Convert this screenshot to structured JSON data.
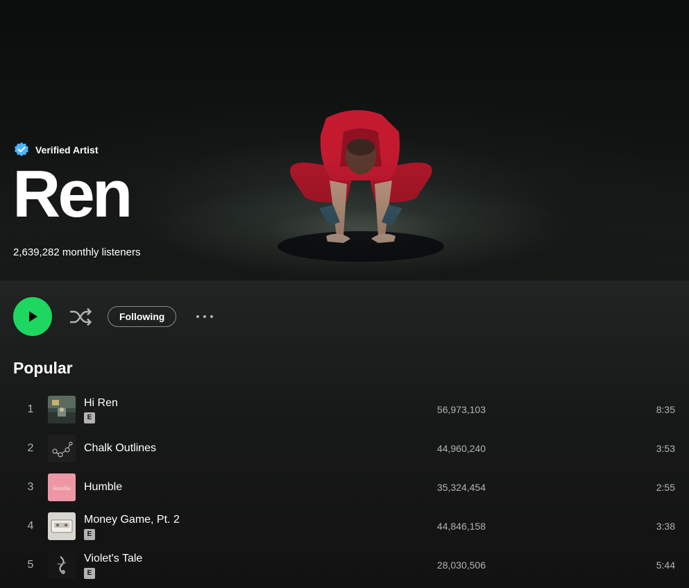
{
  "artist": {
    "verified_label": "Verified Artist",
    "name": "Ren",
    "monthly_listeners": "2,639,282 monthly listeners"
  },
  "actions": {
    "play": "play",
    "shuffle": "shuffle",
    "follow_label": "Following",
    "more": "more"
  },
  "popular": {
    "title": "Popular",
    "tracks": [
      {
        "index": "1",
        "title": "Hi Ren",
        "explicit": "E",
        "plays": "56,973,103",
        "duration": "8:35"
      },
      {
        "index": "2",
        "title": "Chalk Outlines",
        "explicit": "",
        "plays": "44,960,240",
        "duration": "3:53"
      },
      {
        "index": "3",
        "title": "Humble",
        "explicit": "",
        "plays": "35,324,454",
        "duration": "2:55"
      },
      {
        "index": "4",
        "title": "Money Game, Pt. 2",
        "explicit": "E",
        "plays": "44,846,158",
        "duration": "3:38"
      },
      {
        "index": "5",
        "title": "Violet's Tale",
        "explicit": "E",
        "plays": "28,030,506",
        "duration": "5:44"
      }
    ]
  },
  "album_art_lettering": {
    "humble": "Humble"
  },
  "colors": {
    "accent": "#1ed760",
    "verified": "#4cb3ff",
    "background": "#121212",
    "secondary_text": "#b3b3b3"
  }
}
